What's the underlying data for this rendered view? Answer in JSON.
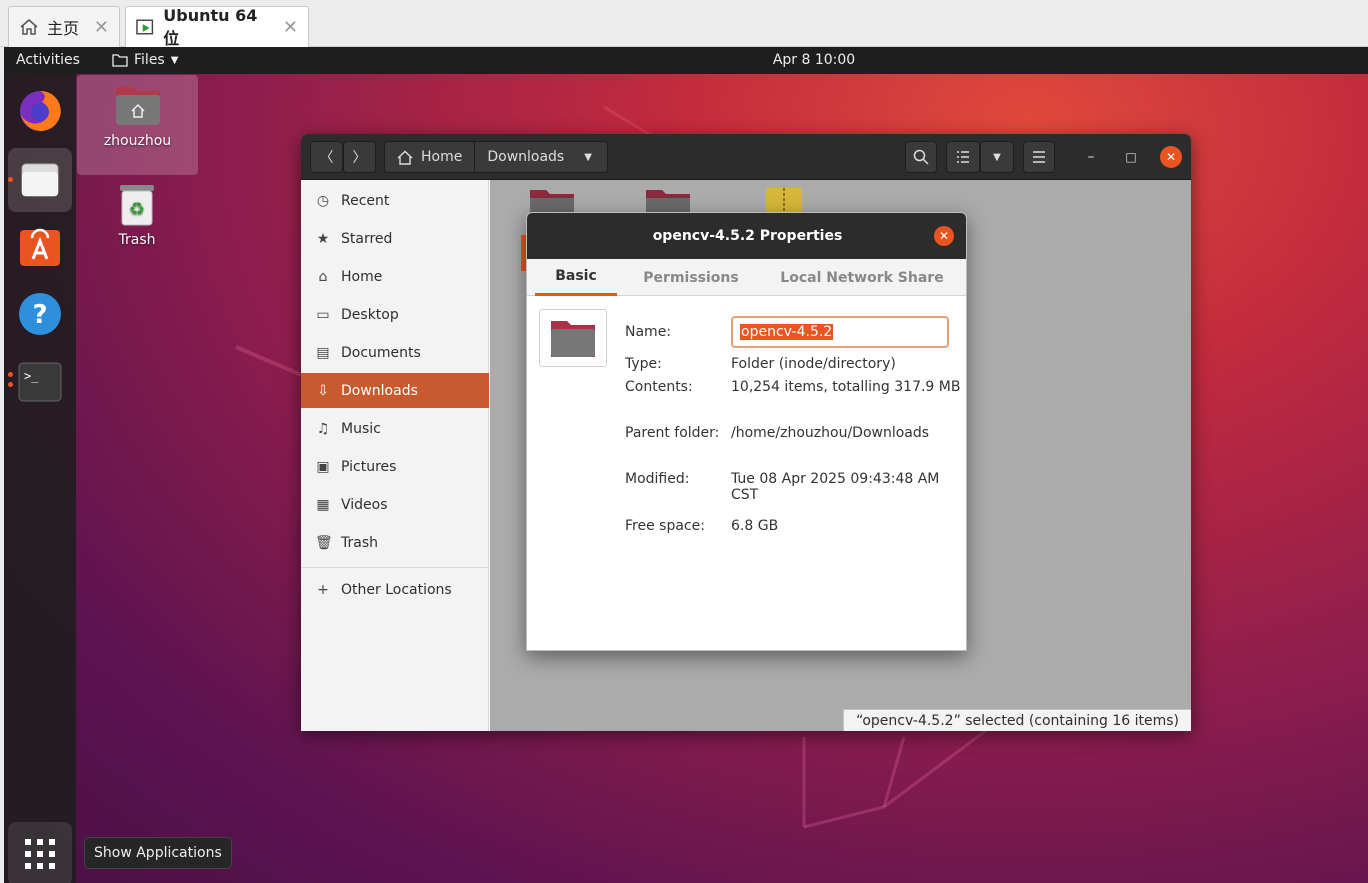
{
  "vm": {
    "tabs": [
      {
        "label": "主页"
      },
      {
        "label": "Ubuntu 64 位"
      }
    ]
  },
  "topbar": {
    "activities": "Activities",
    "app_menu": "Files",
    "clock": "Apr 8  10:00"
  },
  "desktop": {
    "icons": [
      {
        "label": "zhouzhou"
      },
      {
        "label": "Trash"
      }
    ],
    "tooltip": "Show Applications"
  },
  "nautilus": {
    "path": [
      "Home",
      "Downloads"
    ],
    "sidebar": [
      {
        "label": "Recent",
        "icon": "clock-icon"
      },
      {
        "label": "Starred",
        "icon": "star-icon"
      },
      {
        "label": "Home",
        "icon": "home-icon"
      },
      {
        "label": "Desktop",
        "icon": "desktop-icon"
      },
      {
        "label": "Documents",
        "icon": "document-icon"
      },
      {
        "label": "Downloads",
        "icon": "download-icon"
      },
      {
        "label": "Music",
        "icon": "music-icon"
      },
      {
        "label": "Pictures",
        "icon": "picture-icon"
      },
      {
        "label": "Videos",
        "icon": "video-icon"
      },
      {
        "label": "Trash",
        "icon": "trash-icon"
      },
      {
        "label": "Other Locations",
        "icon": "plus-icon"
      }
    ],
    "status": "“opencv-4.5.2” selected  (containing 16 items)"
  },
  "properties": {
    "title": "opencv-4.5.2 Properties",
    "tabs": [
      "Basic",
      "Permissions",
      "Local Network Share"
    ],
    "name_label": "Name:",
    "name_value": "opencv-4.5.2",
    "type_label": "Type:",
    "type_value": "Folder (inode/directory)",
    "contents_label": "Contents:",
    "contents_value": "10,254 items, totalling 317.9 MB",
    "parent_label": "Parent folder:",
    "parent_value": "/home/zhouzhou/Downloads",
    "modified_label": "Modified:",
    "modified_value": "Tue 08 Apr 2025 09:43:48 AM CST",
    "free_label": "Free space:",
    "free_value": "6.8 GB"
  },
  "colors": {
    "accent": "#e95420",
    "sidebar_active": "#c75a2e"
  }
}
